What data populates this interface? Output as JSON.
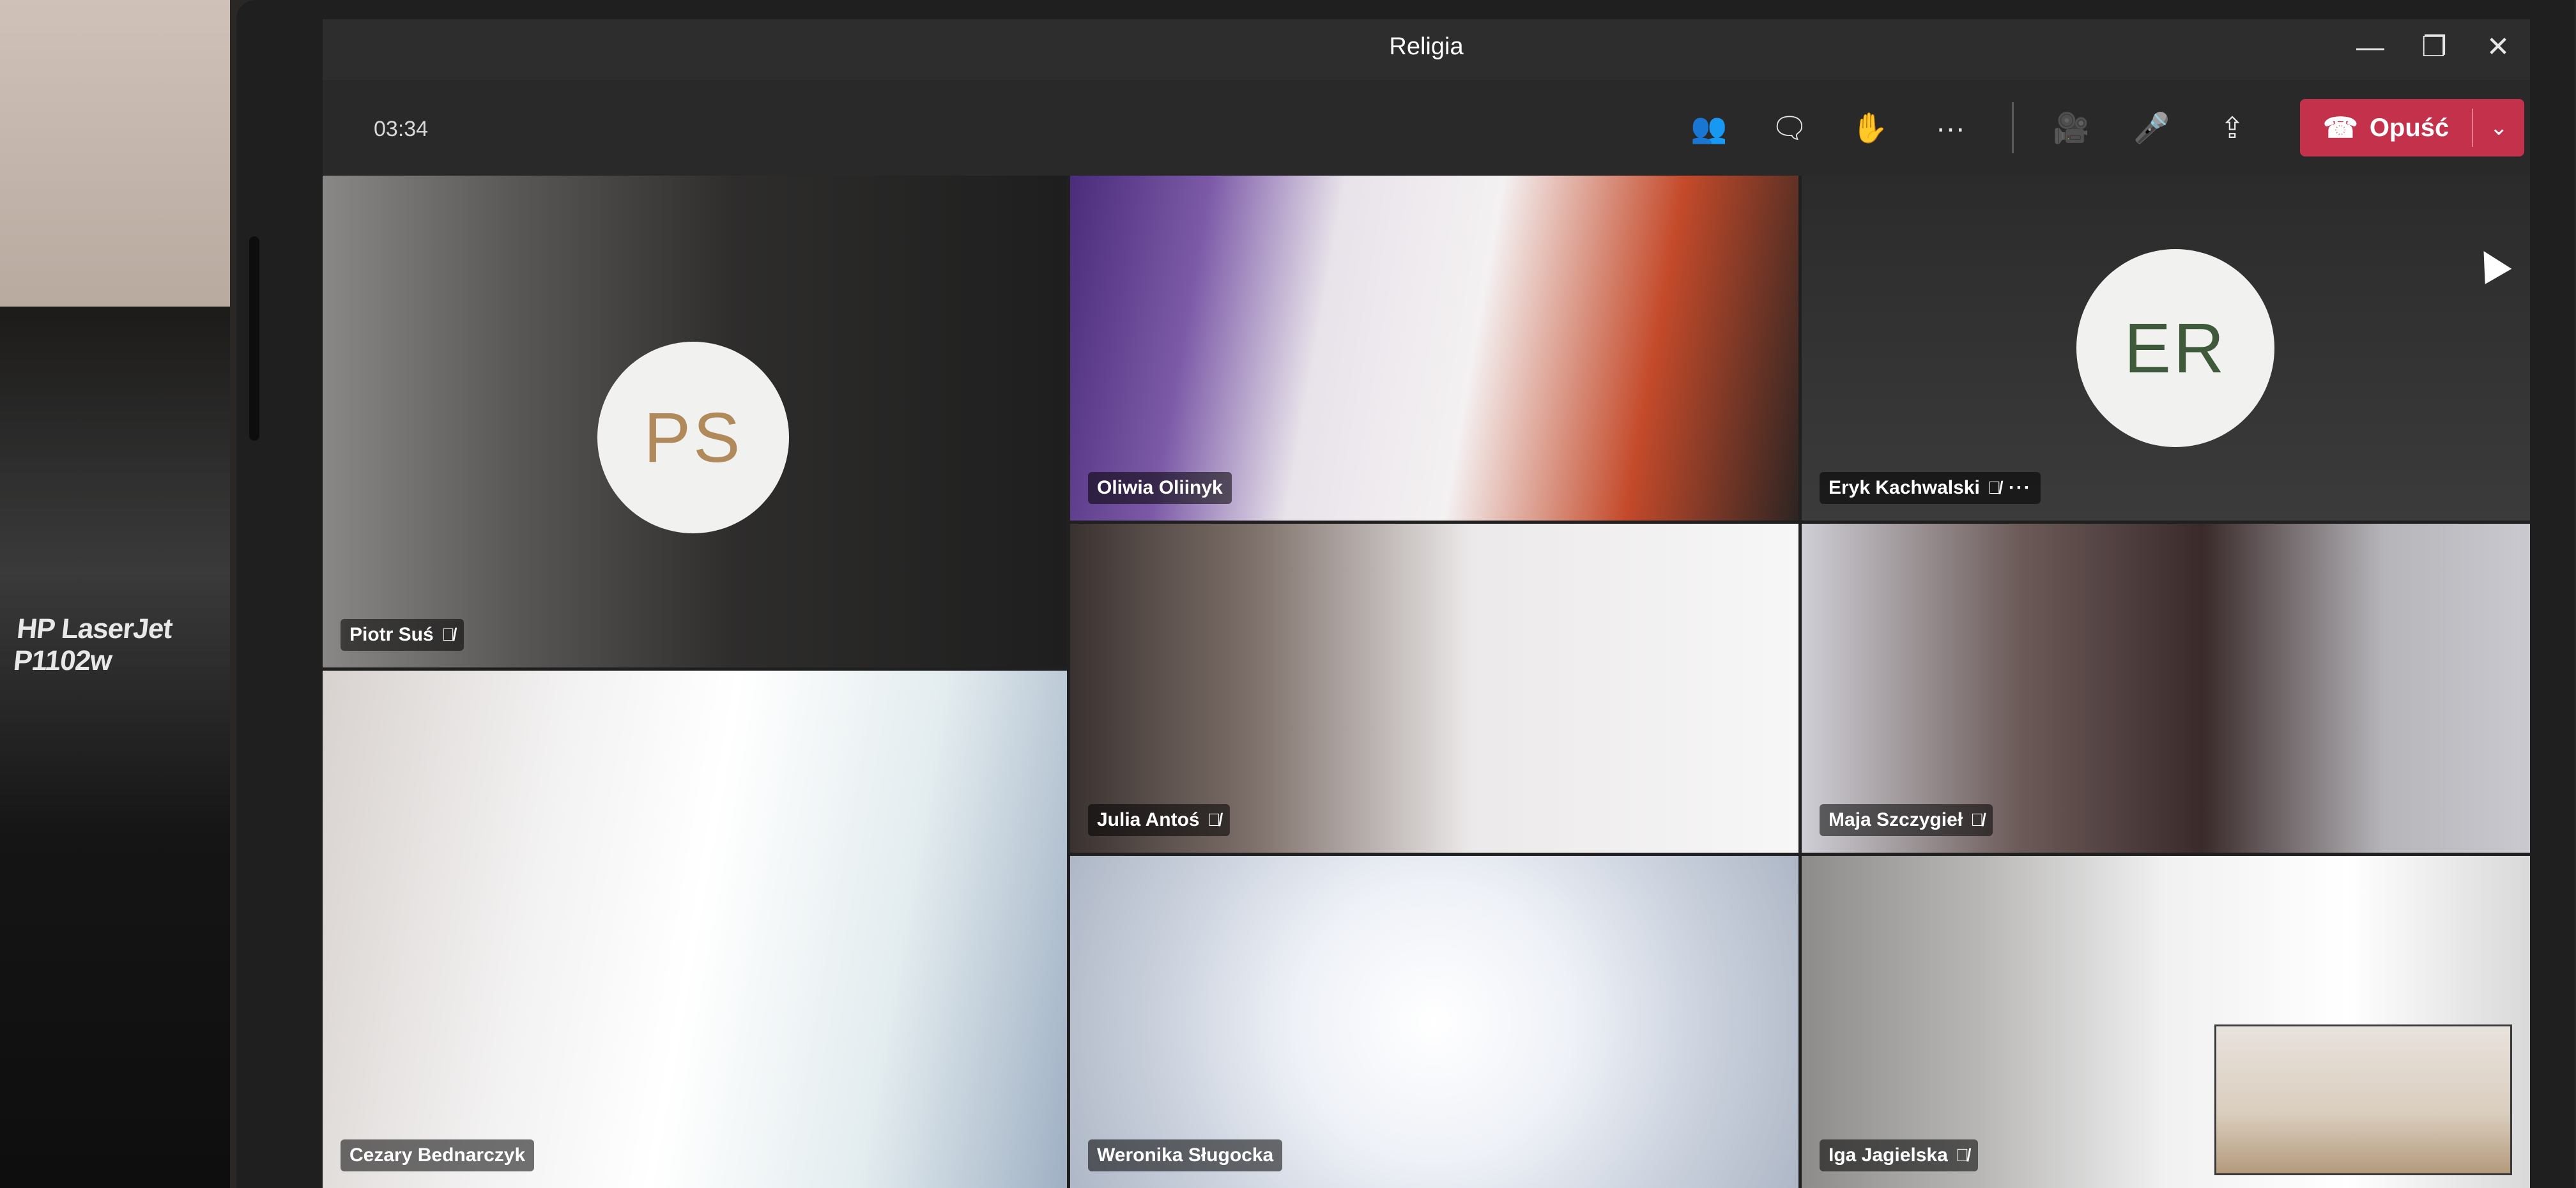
{
  "window": {
    "title": "Religia",
    "controls": [
      {
        "name": "minimize-button",
        "glyph": "—"
      },
      {
        "name": "maximize-button",
        "glyph": "❐"
      },
      {
        "name": "close-button",
        "glyph": "✕"
      }
    ]
  },
  "call": {
    "timer": "03:34",
    "toolbar": [
      {
        "name": "participants-button",
        "icon": "people-icon",
        "glyph": "👥"
      },
      {
        "name": "chat-button",
        "icon": "chat-icon",
        "glyph": "🗨"
      },
      {
        "name": "raise-hand-button",
        "icon": "hand-icon",
        "glyph": "✋"
      },
      {
        "name": "more-actions-button",
        "icon": "ellipsis-icon",
        "glyph": "···"
      }
    ],
    "media": [
      {
        "name": "camera-button",
        "icon": "camera-icon",
        "glyph": "🎥"
      },
      {
        "name": "microphone-button",
        "icon": "microphone-icon",
        "glyph": "🎤"
      },
      {
        "name": "share-screen-button",
        "icon": "share-screen-icon",
        "glyph": "⇪"
      }
    ],
    "leave": {
      "label": "Opuść",
      "icon_glyph": "☎",
      "caret": "⌄"
    }
  },
  "participants": [
    {
      "name": "Piotr Suś",
      "avatar_initials": "PS",
      "avatar_color": "#b08a5a",
      "mic_off": true
    },
    {
      "name": "Oliwia Oliinyk",
      "mic_off": false
    },
    {
      "name": "Eryk Kachwalski",
      "avatar_initials": "ER",
      "avatar_color": "#3f5a3a",
      "mic_off": true,
      "more": "···"
    },
    {
      "name": "Julia Antoś",
      "mic_off": true
    },
    {
      "name": "Maja Szczygieł",
      "mic_off": true
    },
    {
      "name": "Cezary Bednarczyk",
      "mic_off": false
    },
    {
      "name": "Weronika Sługocka",
      "mic_off": false
    },
    {
      "name": "Iga Jagielska",
      "mic_off": true
    }
  ],
  "mic_off_glyph": "🎙̸",
  "background": {
    "printer_label": "HP LaserJet P1102w"
  }
}
